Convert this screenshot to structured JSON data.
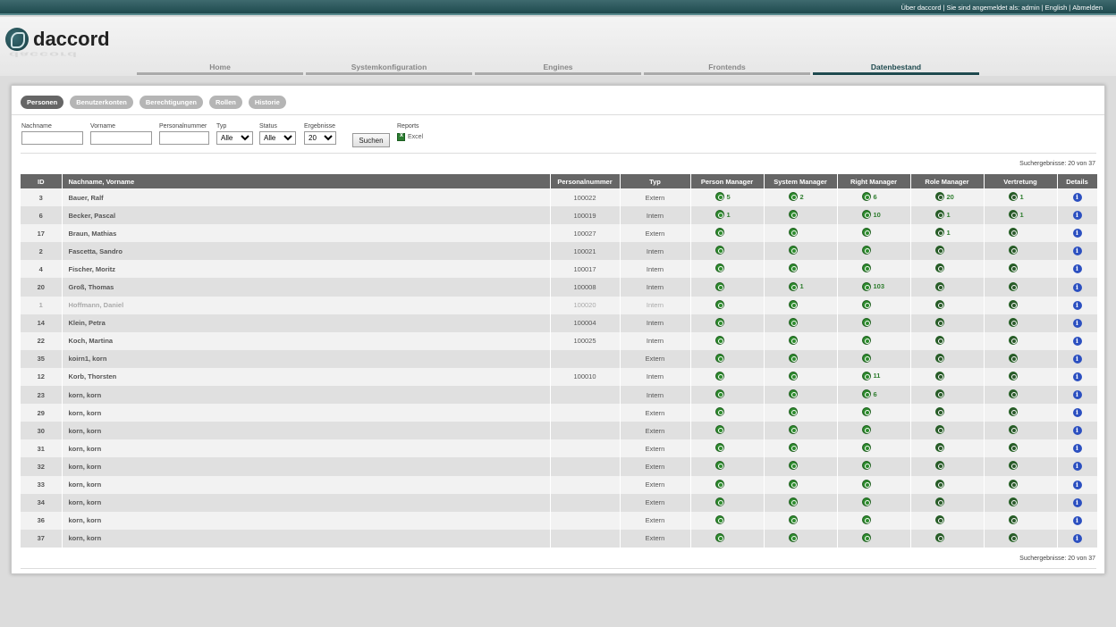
{
  "topbar": {
    "about": "Über daccord",
    "logged_in": "Sie sind angemeldet als: admin",
    "language": "English",
    "logout": "Abmelden"
  },
  "logo": {
    "text": "daccord"
  },
  "nav": [
    {
      "label": "Home",
      "active": false
    },
    {
      "label": "Systemkonfiguration",
      "active": false
    },
    {
      "label": "Engines",
      "active": false
    },
    {
      "label": "Frontends",
      "active": false
    },
    {
      "label": "Datenbestand",
      "active": true
    }
  ],
  "subtabs": [
    {
      "label": "Personen",
      "active": true
    },
    {
      "label": "Benutzerkonten",
      "active": false
    },
    {
      "label": "Berechtigungen",
      "active": false
    },
    {
      "label": "Rollen",
      "active": false
    },
    {
      "label": "Historie",
      "active": false
    }
  ],
  "filters": {
    "nachname_label": "Nachname",
    "nachname_value": "",
    "vorname_label": "Vorname",
    "vorname_value": "",
    "personalnummer_label": "Personalnummer",
    "personalnummer_value": "",
    "typ_label": "Typ",
    "typ_value": "Alle",
    "status_label": "Status",
    "status_value": "Alle",
    "ergebnisse_label": "Ergebnisse",
    "ergebnisse_value": "20",
    "search_button": "Suchen",
    "reports_label": "Reports",
    "excel_label": "Excel"
  },
  "results_text": "Suchergebnisse: 20 von 37",
  "table": {
    "headers": [
      "ID",
      "Nachname, Vorname",
      "Personalnummer",
      "Typ",
      "Person Manager",
      "System Manager",
      "Right Manager",
      "Role Manager",
      "Vertretung",
      "Details"
    ],
    "rows": [
      {
        "id": "3",
        "name": "Bauer, Ralf",
        "pn": "100022",
        "typ": "Extern",
        "pm": "5",
        "sm": "2",
        "rm": "6",
        "rol": "20",
        "vt": "1",
        "inactive": false
      },
      {
        "id": "6",
        "name": "Becker, Pascal",
        "pn": "100019",
        "typ": "Intern",
        "pm": "1",
        "sm": "",
        "rm": "10",
        "rol": "1",
        "vt": "1",
        "inactive": false
      },
      {
        "id": "17",
        "name": "Braun, Mathias",
        "pn": "100027",
        "typ": "Extern",
        "pm": "",
        "sm": "",
        "rm": "",
        "rol": "1",
        "vt": "",
        "inactive": false
      },
      {
        "id": "2",
        "name": "Fascetta, Sandro",
        "pn": "100021",
        "typ": "Intern",
        "pm": "",
        "sm": "",
        "rm": "",
        "rol": "",
        "vt": "",
        "inactive": false
      },
      {
        "id": "4",
        "name": "Fischer, Moritz",
        "pn": "100017",
        "typ": "Intern",
        "pm": "",
        "sm": "",
        "rm": "",
        "rol": "",
        "vt": "",
        "inactive": false
      },
      {
        "id": "20",
        "name": "Groß, Thomas",
        "pn": "100008",
        "typ": "Intern",
        "pm": "",
        "sm": "1",
        "rm": "103",
        "rol": "",
        "vt": "",
        "inactive": false
      },
      {
        "id": "1",
        "name": "Hoffmann, Daniel",
        "pn": "100020",
        "typ": "Intern",
        "pm": "",
        "sm": "",
        "rm": "",
        "rol": "",
        "vt": "",
        "inactive": true
      },
      {
        "id": "14",
        "name": "Klein, Petra",
        "pn": "100004",
        "typ": "Intern",
        "pm": "",
        "sm": "",
        "rm": "",
        "rol": "",
        "vt": "",
        "inactive": false
      },
      {
        "id": "22",
        "name": "Koch, Martina",
        "pn": "100025",
        "typ": "Intern",
        "pm": "",
        "sm": "",
        "rm": "",
        "rol": "",
        "vt": "",
        "inactive": false
      },
      {
        "id": "35",
        "name": "koirn1, korn",
        "pn": "",
        "typ": "Extern",
        "pm": "",
        "sm": "",
        "rm": "",
        "rol": "",
        "vt": "",
        "inactive": false
      },
      {
        "id": "12",
        "name": "Korb, Thorsten",
        "pn": "100010",
        "typ": "Intern",
        "pm": "",
        "sm": "",
        "rm": "11",
        "rol": "",
        "vt": "",
        "inactive": false
      },
      {
        "id": "23",
        "name": "korn, korn",
        "pn": "",
        "typ": "Intern",
        "pm": "",
        "sm": "",
        "rm": "6",
        "rol": "",
        "vt": "",
        "inactive": false
      },
      {
        "id": "29",
        "name": "korn, korn",
        "pn": "",
        "typ": "Extern",
        "pm": "",
        "sm": "",
        "rm": "",
        "rol": "",
        "vt": "",
        "inactive": false
      },
      {
        "id": "30",
        "name": "korn, korn",
        "pn": "",
        "typ": "Extern",
        "pm": "",
        "sm": "",
        "rm": "",
        "rol": "",
        "vt": "",
        "inactive": false
      },
      {
        "id": "31",
        "name": "korn, korn",
        "pn": "",
        "typ": "Extern",
        "pm": "",
        "sm": "",
        "rm": "",
        "rol": "",
        "vt": "",
        "inactive": false
      },
      {
        "id": "32",
        "name": "korn, korn",
        "pn": "",
        "typ": "Extern",
        "pm": "",
        "sm": "",
        "rm": "",
        "rol": "",
        "vt": "",
        "inactive": false
      },
      {
        "id": "33",
        "name": "korn, korn",
        "pn": "",
        "typ": "Extern",
        "pm": "",
        "sm": "",
        "rm": "",
        "rol": "",
        "vt": "",
        "inactive": false
      },
      {
        "id": "34",
        "name": "korn, korn",
        "pn": "",
        "typ": "Extern",
        "pm": "",
        "sm": "",
        "rm": "",
        "rol": "",
        "vt": "",
        "inactive": false
      },
      {
        "id": "36",
        "name": "korn, korn",
        "pn": "",
        "typ": "Extern",
        "pm": "",
        "sm": "",
        "rm": "",
        "rol": "",
        "vt": "",
        "inactive": false
      },
      {
        "id": "37",
        "name": "korn, korn",
        "pn": "",
        "typ": "Extern",
        "pm": "",
        "sm": "",
        "rm": "",
        "rol": "",
        "vt": "",
        "inactive": false
      }
    ]
  },
  "icons": {
    "manager": "manager-green-icon",
    "details": "info-icon",
    "excel": "excel-icon"
  },
  "colors": {
    "brand": "#1f4a4f",
    "manager_icon": "#2e8b2e",
    "info_icon": "#2b4fc0",
    "header_bg": "#666666"
  }
}
